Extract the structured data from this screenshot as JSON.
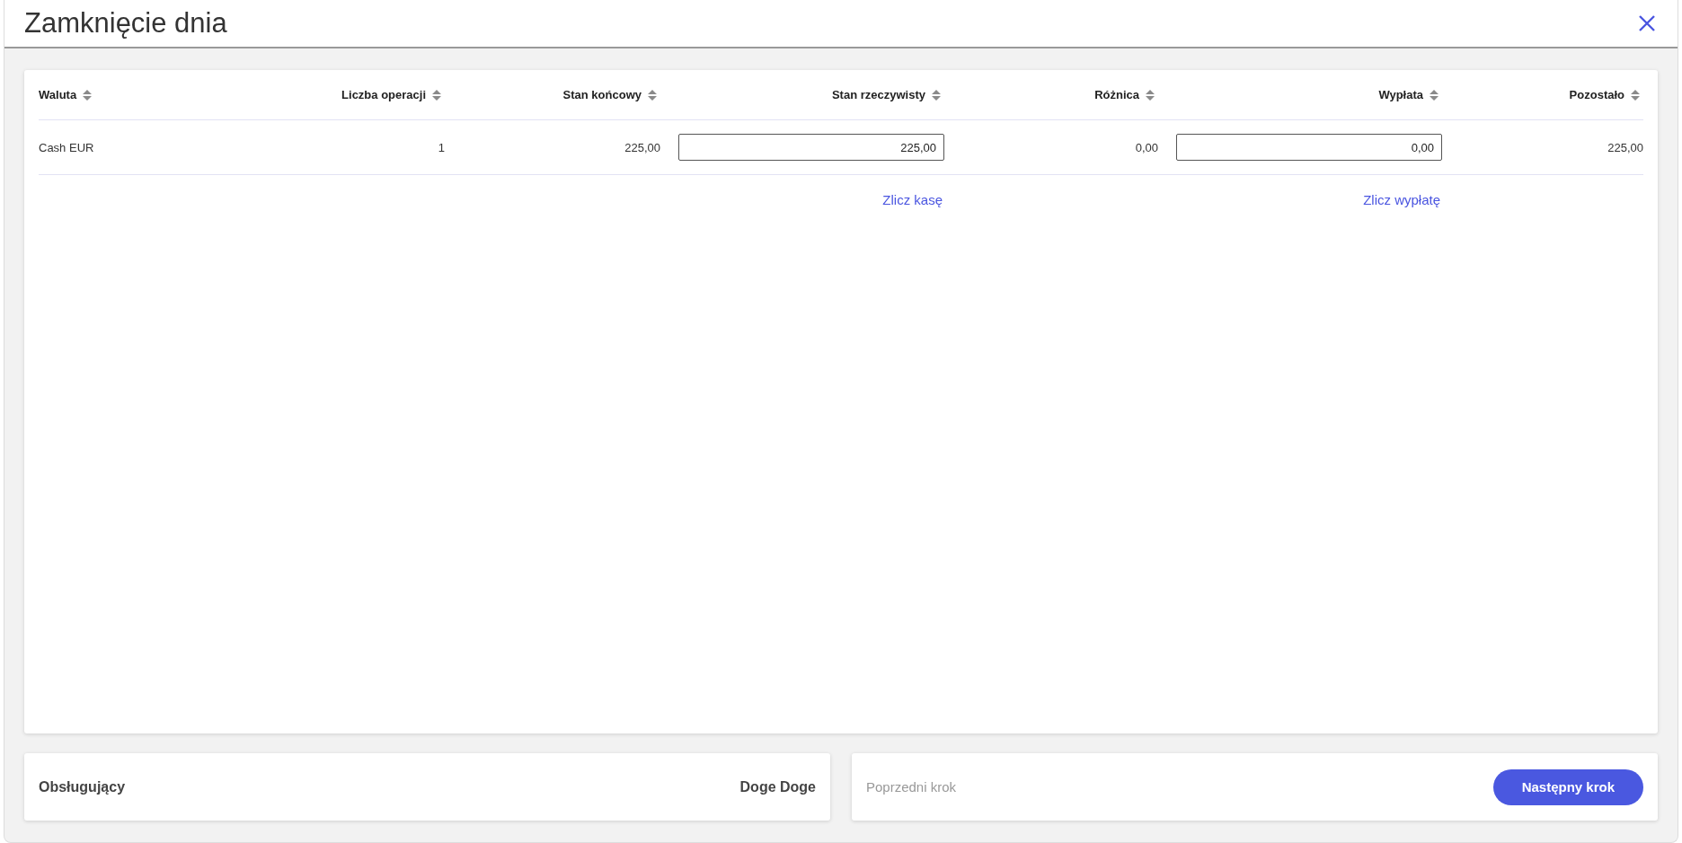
{
  "window": {
    "title": "Zamknięcie dnia"
  },
  "table": {
    "columns": [
      {
        "label": "Waluta"
      },
      {
        "label": "Liczba operacji"
      },
      {
        "label": "Stan końcowy"
      },
      {
        "label": "Stan rzeczywisty",
        "action": "Zlicz kasę"
      },
      {
        "label": "Różnica"
      },
      {
        "label": "Wypłata",
        "action": "Zlicz wypłatę"
      },
      {
        "label": "Pozostało"
      }
    ],
    "rows": [
      {
        "cells": [
          {
            "kind": "text",
            "value": "Cash EUR"
          },
          {
            "kind": "text",
            "value": "1"
          },
          {
            "kind": "text",
            "value": "225,00"
          },
          {
            "kind": "input",
            "value": "225,00"
          },
          {
            "kind": "text",
            "value": "0,00"
          },
          {
            "kind": "input",
            "value": "0,00"
          },
          {
            "kind": "text",
            "value": "225,00"
          }
        ]
      }
    ]
  },
  "operator": {
    "label": "Obsługujący",
    "value": "Doge Doge"
  },
  "navigation": [
    {
      "label": "Poprzedni krok",
      "kind": "text",
      "disabled": true
    },
    {
      "label": "Następny krok",
      "kind": "primary",
      "disabled": false
    }
  ]
}
